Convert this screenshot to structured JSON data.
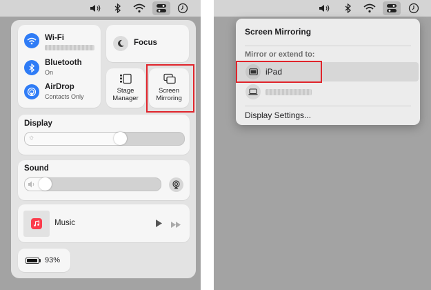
{
  "left": {
    "wifi": {
      "label": "Wi-Fi"
    },
    "bluetooth": {
      "label": "Bluetooth",
      "status": "On"
    },
    "airdrop": {
      "label": "AirDrop",
      "status": "Contacts Only"
    },
    "focus": {
      "label": "Focus"
    },
    "stage_manager": {
      "line1": "Stage",
      "line2": "Manager"
    },
    "screen_mirroring": {
      "line1": "Screen",
      "line2": "Mirroring"
    },
    "display": {
      "label": "Display",
      "level": 0.6
    },
    "sound": {
      "label": "Sound",
      "level": 0.15
    },
    "music": {
      "label": "Music"
    },
    "battery": {
      "label": "93%",
      "level": 0.93
    }
  },
  "right": {
    "menu_title": "Screen Mirroring",
    "section_label": "Mirror or extend to:",
    "devices": [
      {
        "label": "iPad",
        "icon": "ipad-icon"
      },
      {
        "label": "",
        "icon": "laptop-icon"
      }
    ],
    "footer": "Display Settings..."
  },
  "menubar_icons": [
    "volume-icon",
    "bluetooth-icon",
    "wifi-icon",
    "control-center-icon",
    "clock-icon"
  ],
  "colors": {
    "accent": "#2f7cf6",
    "highlight": "#e0242b",
    "music": "#fb3c4c"
  }
}
